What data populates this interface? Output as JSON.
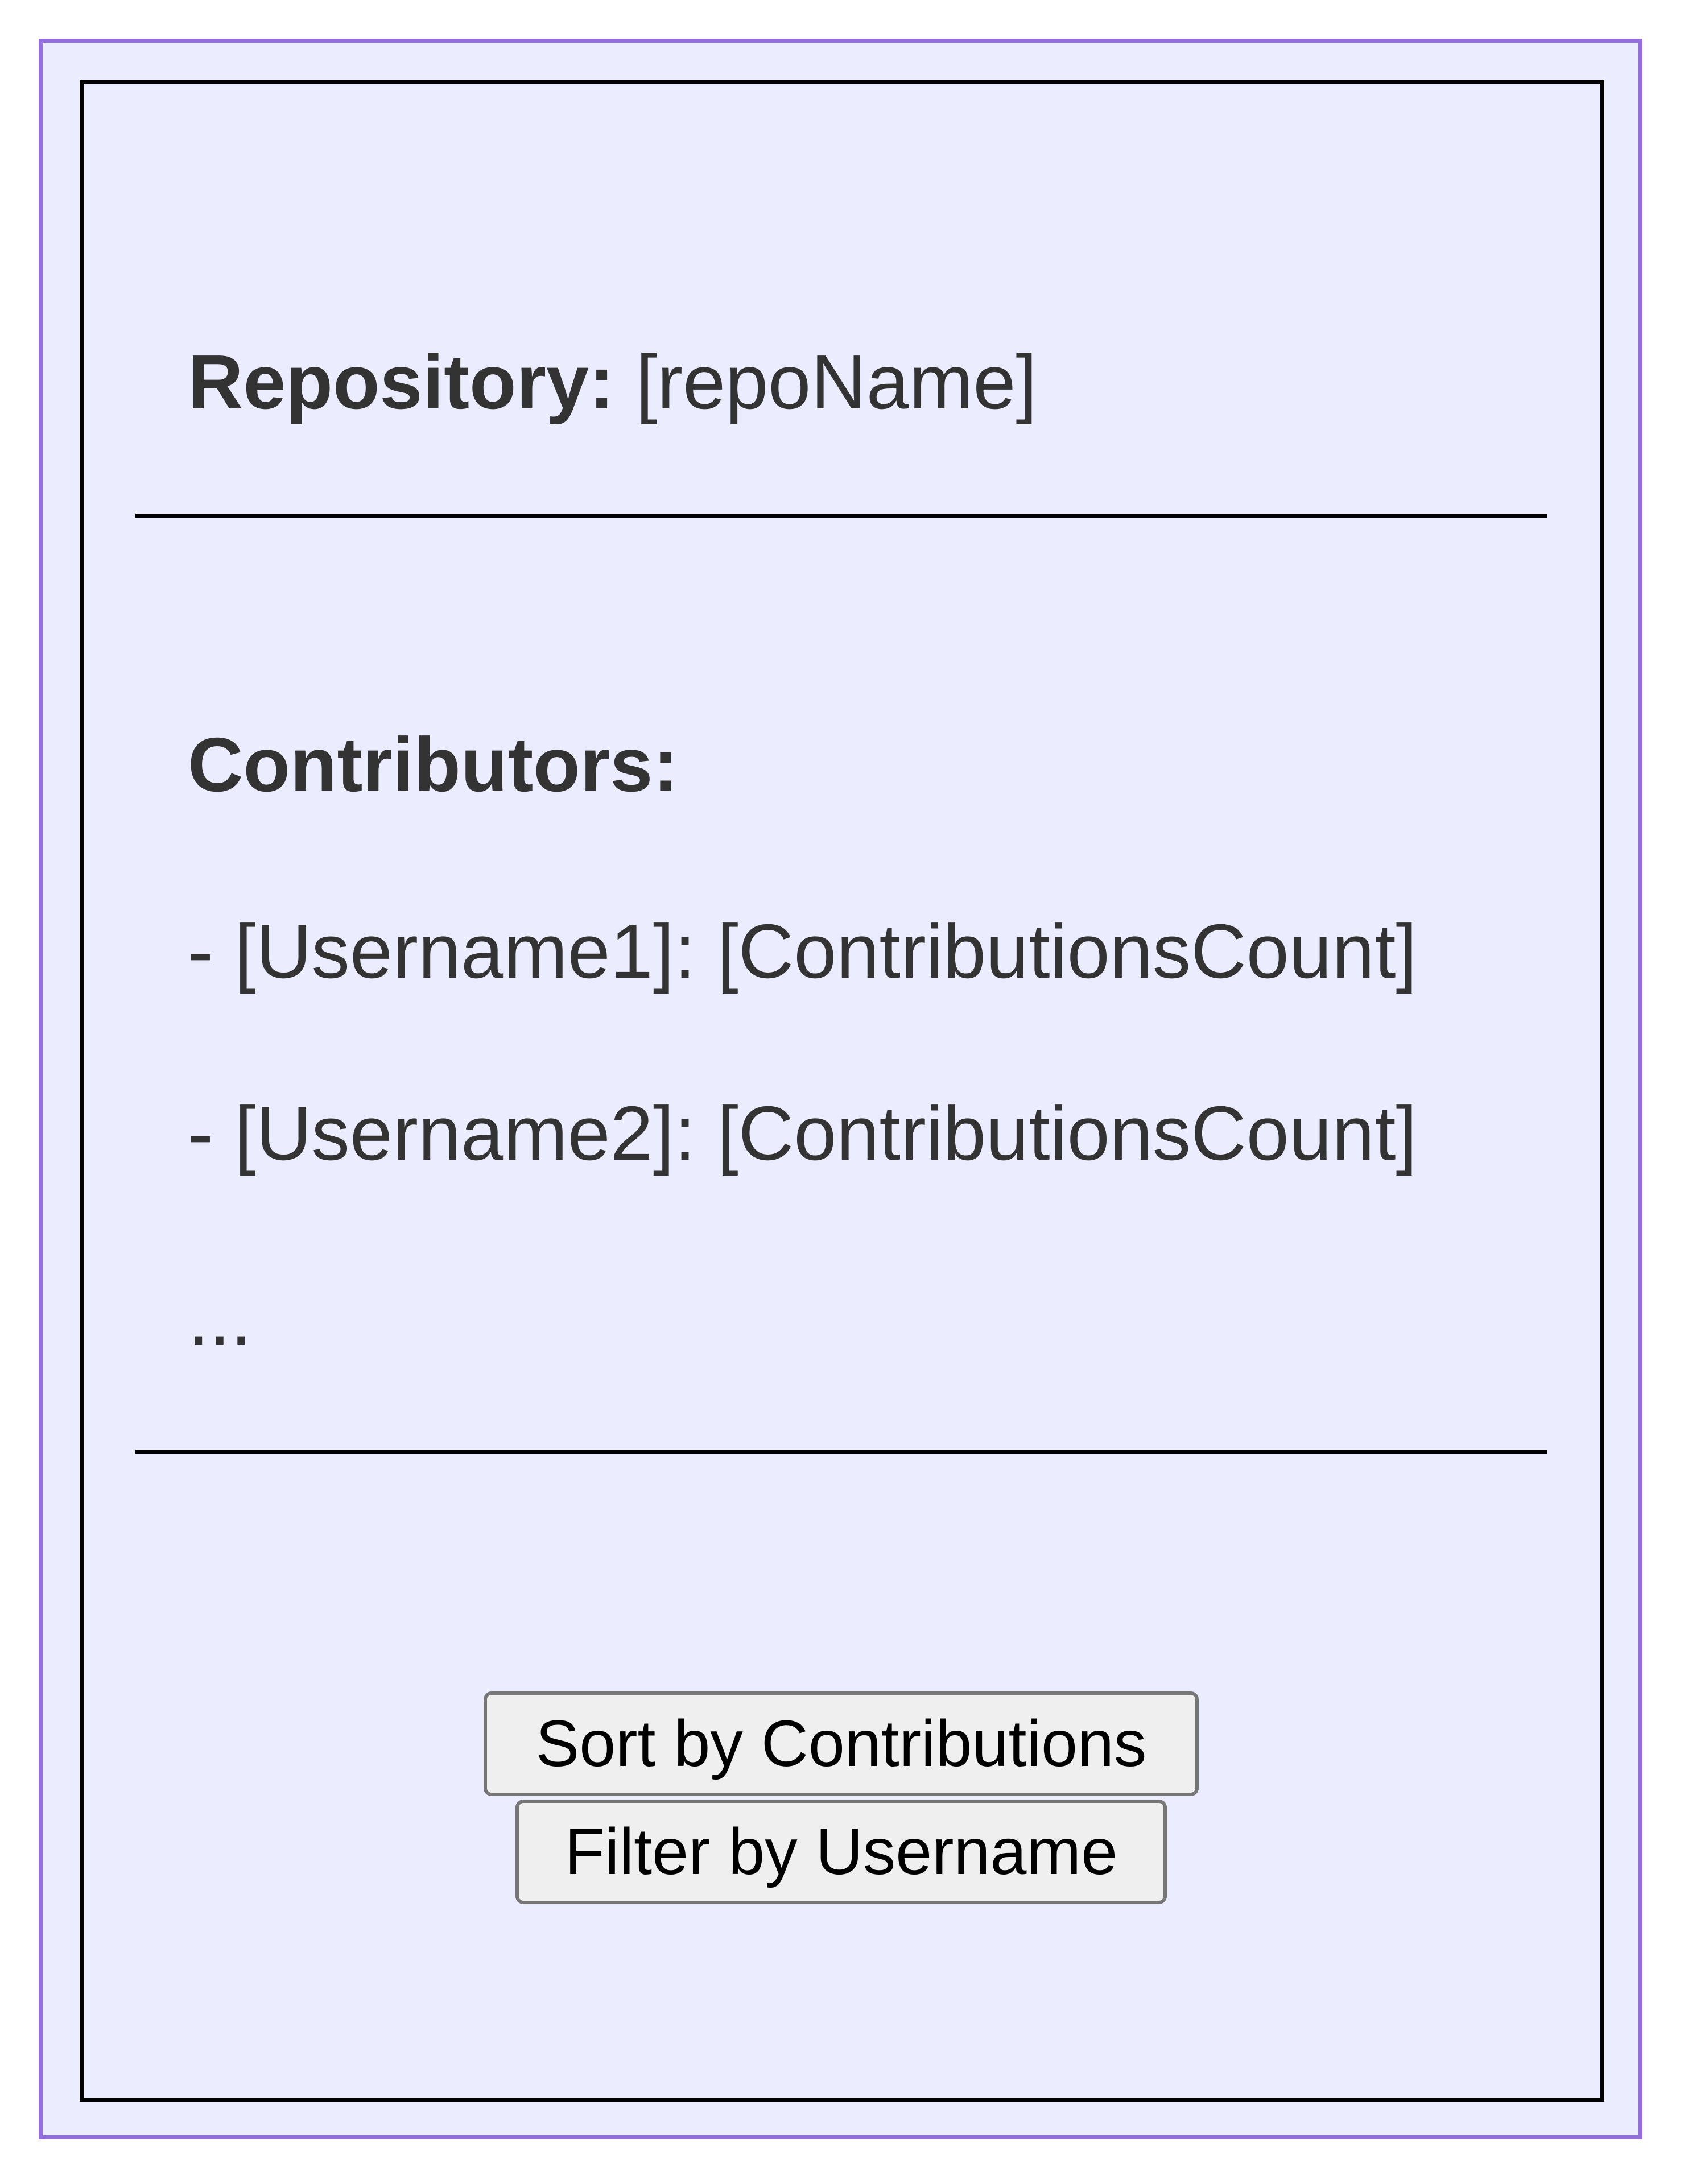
{
  "repository": {
    "label": "Repository:",
    "value": "[repoName]"
  },
  "contributors": {
    "heading": "Contributors:",
    "items": [
      "- [Username1]: [ContributionsCount]",
      "- [Username2]: [ContributionsCount]"
    ],
    "more": "..."
  },
  "actions": {
    "sort_label": "Sort by Contributions",
    "filter_label": "Filter by Username"
  },
  "colors": {
    "outer_border": "#9370DB",
    "background": "#ECECFF",
    "card_border": "#000000",
    "text": "#333333",
    "button_background": "#EFEFEF",
    "button_border": "#767676"
  }
}
